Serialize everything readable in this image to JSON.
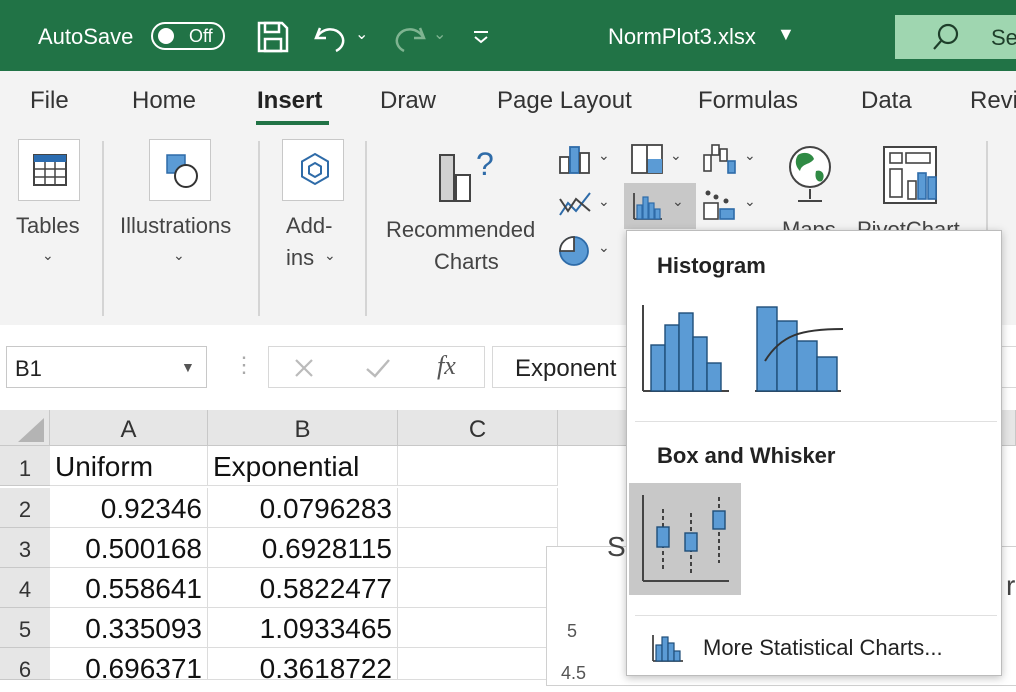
{
  "titlebar": {
    "autosave_label": "AutoSave",
    "autosave_state": "Off",
    "filename": "NormPlot3.xlsx",
    "search_placeholder": "Se"
  },
  "tabs": [
    {
      "label": "File"
    },
    {
      "label": "Home"
    },
    {
      "label": "Insert"
    },
    {
      "label": "Draw"
    },
    {
      "label": "Page Layout"
    },
    {
      "label": "Formulas"
    },
    {
      "label": "Data"
    },
    {
      "label": "Revi"
    }
  ],
  "ribbon": {
    "tables": "Tables",
    "illustrations": "Illustrations",
    "addins_line1": "Add-",
    "addins_line2": "ins",
    "recommended_line1": "Recommended",
    "recommended_line2": "Charts",
    "maps": "Maps",
    "pivotchart": "PivotChart"
  },
  "formula_bar": {
    "name_box": "B1",
    "fx": "fx",
    "value": "Exponent"
  },
  "grid": {
    "columns": [
      "A",
      "B",
      "C"
    ],
    "rows": [
      {
        "n": "1",
        "a": "Uniform",
        "b": "Exponential"
      },
      {
        "n": "2",
        "a": "0.92346",
        "b": "0.0796283"
      },
      {
        "n": "3",
        "a": "0.500168",
        "b": "0.6928115"
      },
      {
        "n": "4",
        "a": "0.558641",
        "b": "0.5822477"
      },
      {
        "n": "5",
        "a": "0.335093",
        "b": "1.0933465"
      },
      {
        "n": "6",
        "a": "0.696371",
        "b": "0.3618722"
      }
    ]
  },
  "chart_behind": {
    "title_fragment": "S",
    "right_fragment": "r",
    "tick_5": "5",
    "tick_45": "4.5"
  },
  "dropdown": {
    "histogram_header": "Histogram",
    "box_header": "Box and Whisker",
    "more_link": "More Statistical Charts...",
    "accent": "#5b9bd5"
  },
  "colors": {
    "excel_green": "#217346",
    "ribbon_bg": "#f3f3f3"
  }
}
